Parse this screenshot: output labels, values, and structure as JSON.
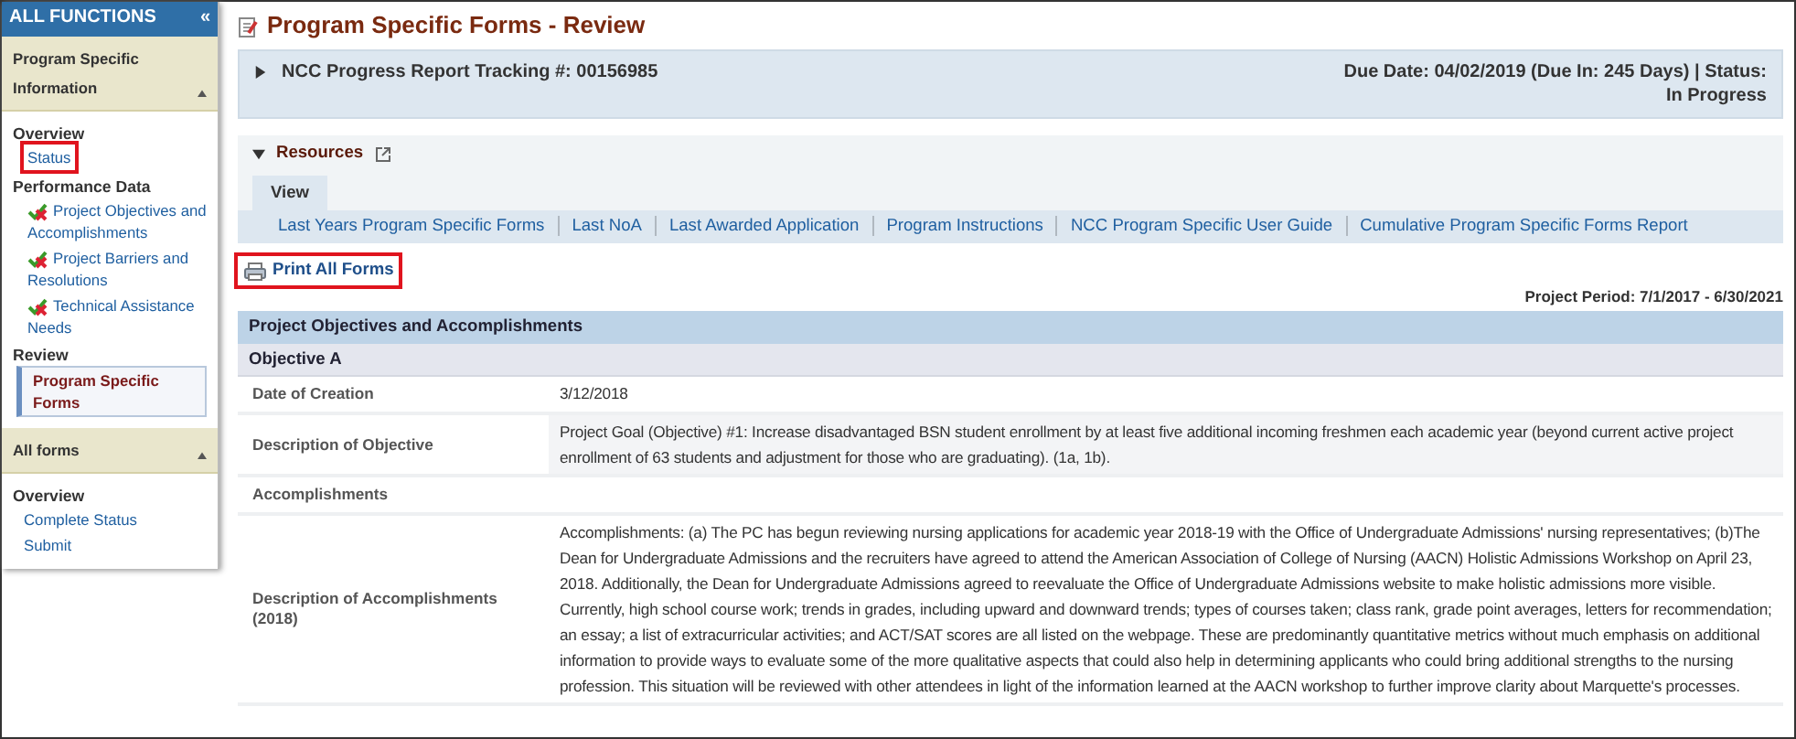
{
  "sidebar": {
    "title": "ALL FUNCTIONS",
    "collapse_icon": "«",
    "sections": [
      {
        "title": "Program Specific Information",
        "expanded": true,
        "groups": [
          {
            "heading": "Overview",
            "items": [
              {
                "label": "Status",
                "kind": "link",
                "selected": false,
                "highlighted": true
              }
            ]
          },
          {
            "heading": "Performance Data",
            "items": [
              {
                "label": "Project Objectives and Accomplishments",
                "kind": "status",
                "selected": false,
                "highlighted": false
              },
              {
                "label": "Project Barriers and Resolutions",
                "kind": "status",
                "selected": false,
                "highlighted": false
              },
              {
                "label": "Technical Assistance Needs",
                "kind": "status",
                "selected": false,
                "highlighted": false
              }
            ]
          },
          {
            "heading": "Review",
            "items": [
              {
                "label": "Program Specific Forms",
                "kind": "link",
                "selected": true,
                "highlighted": false
              }
            ]
          }
        ]
      },
      {
        "title": "All forms",
        "expanded": true,
        "groups": [
          {
            "heading": "Overview",
            "items": [
              {
                "label": "Complete Status",
                "kind": "link",
                "selected": false,
                "highlighted": false
              },
              {
                "label": "Submit",
                "kind": "link",
                "selected": false,
                "highlighted": false
              }
            ]
          }
        ]
      }
    ]
  },
  "page_title": "Program Specific Forms - Review",
  "tracking": {
    "title": "NCC Progress Report Tracking #: 00156985",
    "expanded": false,
    "due": "Due Date: 04/02/2019 (Due In: 245 Days) | Status: In Progress"
  },
  "resources": {
    "title": "Resources",
    "expanded": true,
    "tabs": [
      {
        "label": "View",
        "selected": true
      }
    ],
    "links": [
      "Last Years Program Specific Forms",
      "Last NoA",
      "Last Awarded Application",
      "Program Instructions",
      "NCC Program Specific User Guide",
      "Cumulative Program Specific Forms Report"
    ]
  },
  "print_button": {
    "label": "Print All Forms",
    "highlighted": true
  },
  "project_period": "Project Period: 7/1/2017 - 6/30/2021",
  "form": {
    "title": "Project Objectives and Accomplishments",
    "subtitle": "Objective A",
    "rows": [
      {
        "kind": "field",
        "label": "Date of Creation",
        "value": "3/12/2018"
      },
      {
        "kind": "field",
        "label": "Description of Objective",
        "value": "Project Goal (Objective) #1: Increase disadvantaged BSN student enrollment by at least five additional incoming freshmen each academic year (beyond current active project enrollment of 63 students and adjustment for those who are graduating). (1a, 1b)."
      },
      {
        "kind": "heading",
        "label": "Accomplishments"
      },
      {
        "kind": "field",
        "label": "Description of Accomplishments (2018)",
        "value": "Accomplishments: (a) The PC has begun reviewing nursing applications for academic year 2018-19 with the Office of Undergraduate Admissions' nursing representatives; (b)The Dean for Undergraduate Admissions and the recruiters have agreed to attend the American Association of College of Nursing (AACN) Holistic Admissions Workshop on April 23, 2018. Additionally, the Dean for Undergraduate Admissions agreed to reevaluate the Office of Undergraduate Admissions website to make holistic admissions more visible. Currently, high school course work; trends in grades, including upward and downward trends; types of courses taken; class rank, grade point averages, letters for recommendation; an essay; a list of extracurricular activities; and ACT/SAT scores are all listed on the webpage. These are predominantly quantitative metrics without much emphasis on additional information to provide ways to evaluate some of the more qualitative aspects that could also help in determining applicants who could bring additional strengths to the nursing profession. This situation will be reviewed with other attendees in light of the information learned at the AACN workshop to further improve clarity about Marquette's processes."
      }
    ]
  }
}
